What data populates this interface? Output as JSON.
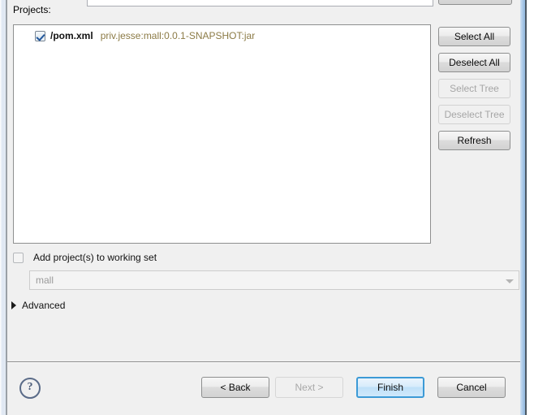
{
  "dialog": {
    "projects_label": "Projects:",
    "tree": {
      "rows": [
        {
          "checked": true,
          "name": "/pom.xml",
          "coordinates": "priv.jesse:mall:0.0.1-SNAPSHOT:jar"
        }
      ]
    },
    "side_buttons": [
      {
        "label": "Select All",
        "enabled": true
      },
      {
        "label": "Deselect All",
        "enabled": true
      },
      {
        "label": "Select Tree",
        "enabled": false
      },
      {
        "label": "Deselect Tree",
        "enabled": false
      },
      {
        "label": "Refresh",
        "enabled": true
      }
    ],
    "working_set": {
      "checkbox_label": "Add project(s) to working set",
      "checked": false,
      "combo_value": "mall"
    },
    "advanced": {
      "label": "Advanced",
      "expanded": false
    },
    "footer": {
      "help_glyph": "?",
      "back_label": "< Back",
      "next_label": "Next >",
      "finish_label": "Finish",
      "cancel_label": "Cancel"
    }
  },
  "colors": {
    "dialog_background": "#f0f0f0",
    "tree_background": "#ffffff",
    "coordinate_text": "#8c7b46",
    "default_button_border": "#3c9ad6",
    "disabled_text": "#a6a6a6",
    "frame_accent": "#a8c8e8"
  }
}
